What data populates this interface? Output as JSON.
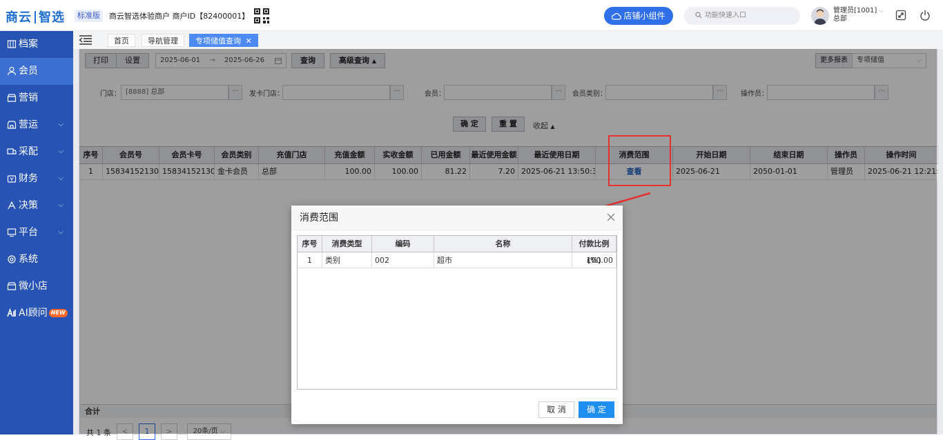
{
  "header": {
    "logo_left": "商云",
    "logo_right": "智选",
    "edition": "标准版",
    "merchant": "商云智选体验商户   商户ID【82400001】",
    "widget_button": "店铺小组件",
    "search_placeholder": "功能快速入口",
    "user_name": "管理员[1001]",
    "user_store": "总部"
  },
  "sidebar": {
    "items": [
      {
        "label": "档案",
        "icon": "archive-icon"
      },
      {
        "label": "会员",
        "icon": "user-icon",
        "active": true
      },
      {
        "label": "营销",
        "icon": "shop-icon"
      },
      {
        "label": "营运",
        "icon": "store-icon"
      },
      {
        "label": "采配",
        "icon": "truck-icon"
      },
      {
        "label": "财务",
        "icon": "wallet-icon"
      },
      {
        "label": "决策",
        "icon": "decision-icon"
      },
      {
        "label": "平台",
        "icon": "monitor-icon"
      },
      {
        "label": "系统",
        "icon": "settings-icon"
      },
      {
        "label": "微小店",
        "icon": "mini-store-icon"
      },
      {
        "label": "AI顾问",
        "icon": "ai-icon",
        "badge": "NEW"
      }
    ]
  },
  "tabs": [
    "首页",
    "导航管理",
    "专项储值查询"
  ],
  "toolbar": {
    "print": "打印",
    "settings": "设置",
    "date_start": "2025-06-01",
    "date_arrow": "→",
    "date_end": "2025-06-26",
    "query": "查询",
    "advanced_query": "高级查询",
    "more_reports": "更多报表",
    "report_select": "专项储值"
  },
  "filters": {
    "store_label": "门店：",
    "store_value": "[8888]   总部",
    "issue_store_label": "发卡门店：",
    "member_label": "会员：",
    "member_type_label": "会员类别：",
    "operator_label": "操作员：",
    "dots": "···",
    "confirm": "确 定",
    "reset": "重 置",
    "collapse": "收起"
  },
  "grid": {
    "headers": [
      "序号",
      "会员号",
      "会员卡号",
      "会员类别",
      "充值门店",
      "充值金额",
      "实收金额",
      "已用金额",
      "最近使用金额",
      "最近使用日期",
      "消费范围",
      "开始日期",
      "结束日期",
      "操作员",
      "操作时间"
    ],
    "rows": [
      [
        "1",
        "15834152130",
        "15834152130",
        "金卡会员",
        "总部",
        "100.00",
        "100.00",
        "81.22",
        "7.20",
        "2025-06-21 13:50:35",
        "查看",
        "2025-06-21",
        "2050-01-01",
        "管理员",
        "2025-06-21 12:21:"
      ]
    ],
    "total_label": "合计"
  },
  "pager": {
    "total": "共 1 条",
    "prev": "<",
    "page": "1",
    "next": ">",
    "page_size": "20条/页"
  },
  "dialog": {
    "title": "消费范围",
    "headers": [
      "序号",
      "消费类型",
      "编码",
      "名称",
      "付款比例(%)"
    ],
    "rows": [
      [
        "1",
        "类别",
        "002",
        "超市",
        "100.00"
      ]
    ],
    "cancel": "取 消",
    "confirm": "确 定"
  },
  "colors": {
    "sidebar": "#2653b4",
    "accent": "#2f6fe9",
    "highlight": "#e53030"
  }
}
